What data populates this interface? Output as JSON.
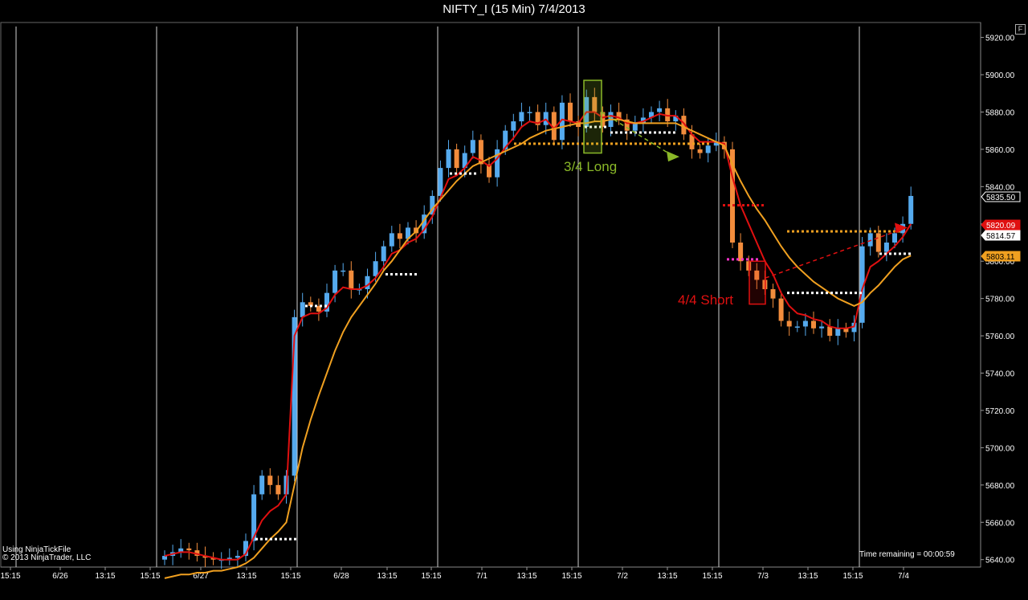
{
  "title": "NIFTY_I (15 Min)  7/4/2013",
  "panel_button": "F",
  "footer": {
    "source": "Using NinjaTickFile",
    "copyright": "© 2013 NinjaTrader, LLC",
    "time_remaining": "Time remaining = 00:00:59"
  },
  "chart_data": {
    "type": "candlestick",
    "timeframe": "15 Min",
    "instrument": "NIFTY_I",
    "ylim": [
      5636,
      5928
    ],
    "y_ticks": [
      5640,
      5660,
      5680,
      5700,
      5720,
      5740,
      5760,
      5780,
      5800,
      5820,
      5840,
      5860,
      5880,
      5900,
      5920
    ],
    "y_tick_labels": [
      "5640.00",
      "5660.00",
      "5680.00",
      "5700.00",
      "5720.00",
      "5740.00",
      "5760.00",
      "5780.00",
      "5800.00",
      "5820.00",
      "5840.00",
      "5860.00",
      "5880.00",
      "5900.00",
      "5920.00"
    ],
    "x_ticks": [
      "15:15",
      "6/26",
      "13:15",
      "15:15",
      "6/27",
      "13:15",
      "15:15",
      "6/28",
      "13:15",
      "15:15",
      "7/1",
      "13:15",
      "15:15",
      "7/2",
      "13:15",
      "15:15",
      "7/3",
      "13:15",
      "15:15",
      "7/4"
    ],
    "session_separators": [
      "6/26",
      "6/27",
      "6/28",
      "7/1",
      "7/2",
      "7/3",
      "7/4"
    ],
    "colors": {
      "bull_candle": "#55aaee",
      "bear_candle": "#f28c3c",
      "fast_ma": "#e01010",
      "slow_ma": "#f0a020",
      "background": "#000000",
      "grid": "#ffffff"
    },
    "close_series": [
      5642,
      5644,
      5646,
      5645,
      5642,
      5641,
      5640,
      5640,
      5641,
      5642,
      5650,
      5675,
      5685,
      5680,
      5675,
      5685,
      5770,
      5778,
      5776,
      5773,
      5783,
      5795,
      5795,
      5785,
      5785,
      5792,
      5800,
      5808,
      5815,
      5812,
      5818,
      5815,
      5825,
      5835,
      5850,
      5860,
      5850,
      5858,
      5865,
      5852,
      5845,
      5860,
      5870,
      5875,
      5880,
      5880,
      5873,
      5880,
      5865,
      5885,
      5875,
      5872,
      5888,
      5880,
      5872,
      5880,
      5876,
      5870,
      5874,
      5877,
      5880,
      5882,
      5875,
      5878,
      5868,
      5860,
      5858,
      5862,
      5864,
      5860,
      5810,
      5800,
      5795,
      5790,
      5785,
      5780,
      5768,
      5765,
      5765,
      5768,
      5764,
      5765,
      5760,
      5764,
      5762,
      5767,
      5808,
      5815,
      5805,
      5810,
      5815,
      5820,
      5835
    ],
    "series": [
      {
        "name": "",
        "role": "fast moving average",
        "values": [
          5642,
          5643,
          5644,
          5644,
          5643,
          5642,
          5641,
          5640,
          5640,
          5640,
          5643,
          5652,
          5661,
          5666,
          5669,
          5675,
          5760,
          5770,
          5772,
          5772,
          5775,
          5782,
          5786,
          5785,
          5785,
          5787,
          5791,
          5797,
          5804,
          5806,
          5810,
          5812,
          5817,
          5824,
          5834,
          5844,
          5846,
          5850,
          5856,
          5854,
          5851,
          5855,
          5861,
          5866,
          5872,
          5875,
          5874,
          5876,
          5871,
          5876,
          5875,
          5874,
          5880,
          5880,
          5877,
          5878,
          5877,
          5874,
          5874,
          5875,
          5877,
          5879,
          5878,
          5878,
          5874,
          5868,
          5864,
          5864,
          5864,
          5863,
          5845,
          5830,
          5820,
          5810,
          5800,
          5793,
          5783,
          5776,
          5772,
          5771,
          5769,
          5768,
          5765,
          5764,
          5764,
          5765,
          5785,
          5797,
          5800,
          5804,
          5808,
          5813,
          5820
        ]
      },
      {
        "name": "",
        "role": "slow moving average",
        "values": [
          5630,
          5631,
          5632,
          5632,
          5633,
          5633,
          5634,
          5634,
          5635,
          5636,
          5638,
          5641,
          5646,
          5651,
          5655,
          5660,
          5680,
          5700,
          5715,
          5728,
          5740,
          5752,
          5762,
          5770,
          5776,
          5782,
          5788,
          5795,
          5800,
          5806,
          5812,
          5816,
          5822,
          5828,
          5833,
          5838,
          5843,
          5847,
          5851,
          5853,
          5855,
          5857,
          5859,
          5861,
          5863,
          5866,
          5868,
          5870,
          5871,
          5872,
          5873,
          5874,
          5874,
          5875,
          5875,
          5876,
          5876,
          5875,
          5874,
          5874,
          5874,
          5874,
          5874,
          5874,
          5872,
          5870,
          5868,
          5866,
          5864,
          5862,
          5852,
          5843,
          5835,
          5828,
          5822,
          5815,
          5808,
          5802,
          5797,
          5793,
          5789,
          5786,
          5783,
          5780,
          5778,
          5776,
          5778,
          5783,
          5787,
          5792,
          5797,
          5801,
          5803
        ]
      }
    ],
    "price_labels": [
      {
        "text": "5835.50",
        "value": 5835.5,
        "style": "last price"
      },
      {
        "text": "5820.09",
        "value": 5820.09,
        "style": "fast ma"
      },
      {
        "text": "5814.57",
        "value": 5814.57,
        "style": "level"
      },
      {
        "text": "5803.11",
        "value": 5803.11,
        "style": "slow ma"
      }
    ],
    "annotations": [
      {
        "text": "3/4 Long",
        "color": "#8ab828"
      },
      {
        "text": "4/4 Short",
        "color": "#e01010"
      }
    ]
  }
}
